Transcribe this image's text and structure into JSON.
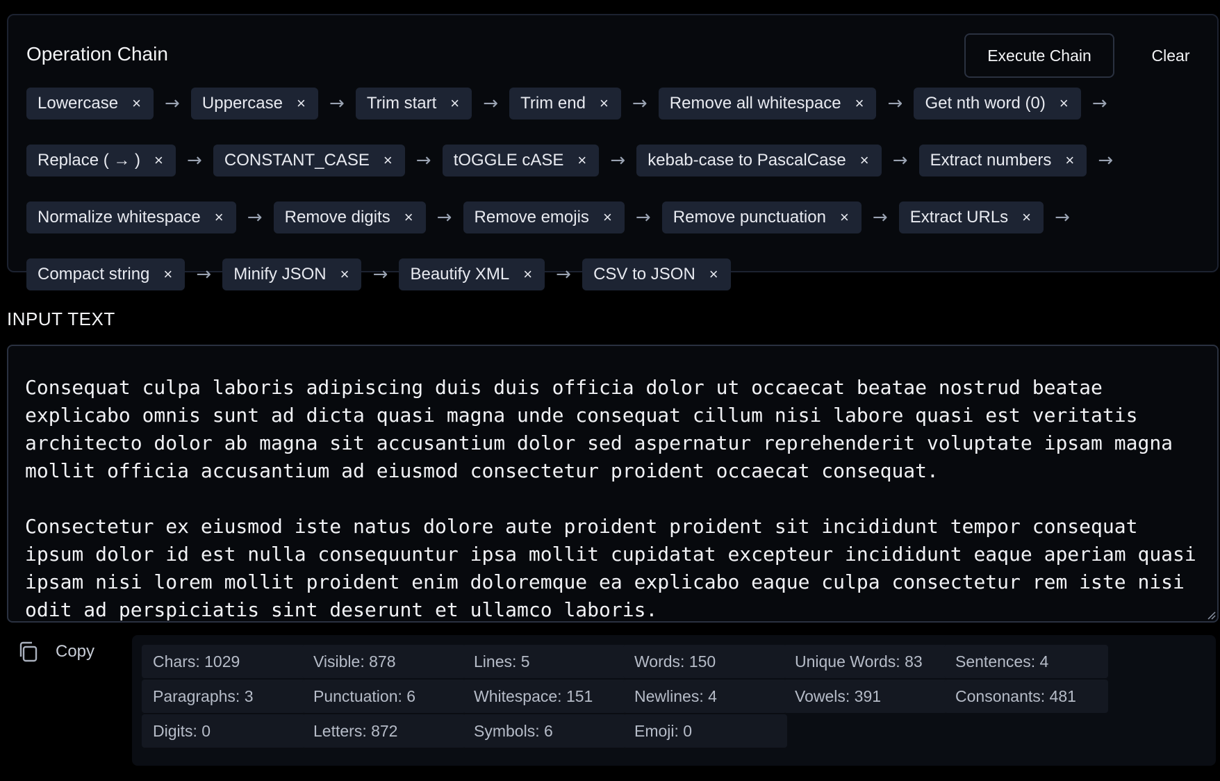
{
  "chain": {
    "title": "Operation Chain",
    "execute_label": "Execute Chain",
    "clear_label": "Clear",
    "close_glyph": "×",
    "arrow_glyph": "→",
    "operations": [
      "Lowercase",
      "Uppercase",
      "Trim start",
      "Trim end",
      "Remove all whitespace",
      "Get nth word (0)",
      "Replace ( → )",
      "CONSTANT_CASE",
      "tOGGLE cASE",
      "kebab-case to PascalCase",
      "Extract numbers",
      "Normalize whitespace",
      "Remove digits",
      "Remove emojis",
      "Remove punctuation",
      "Extract URLs",
      "Compact string",
      "Minify JSON",
      "Beautify XML",
      "CSV to JSON"
    ]
  },
  "input": {
    "label": "INPUT TEXT",
    "value": "Consequat culpa laboris adipiscing duis duis officia dolor ut occaecat beatae nostrud beatae explicabo omnis sunt ad dicta quasi magna unde consequat cillum nisi labore quasi est veritatis architecto dolor ab magna sit accusantium dolor sed aspernatur reprehenderit voluptate ipsam magna mollit officia accusantium ad eiusmod consectetur proident occaecat consequat.\n\nConsectetur ex eiusmod iste natus dolore aute proident proident sit incididunt tempor consequat ipsum dolor id est nulla consequuntur ipsa mollit cupidatat excepteur incididunt eaque aperiam quasi ipsam nisi lorem mollit proident enim doloremque ea explicabo eaque culpa consectetur rem iste nisi odit ad perspiciatis sint deserunt et ullamco laboris."
  },
  "copy": {
    "label": "Copy",
    "icon": "copy-icon"
  },
  "stats": [
    "Chars: 1029",
    "Visible: 878",
    "Lines: 5",
    "Words: 150",
    "Unique Words: 83",
    "Sentences: 4",
    "Paragraphs: 3",
    "Punctuation: 6",
    "Whitespace: 151",
    "Newlines: 4",
    "Vowels: 391",
    "Consonants: 481",
    "Digits: 0",
    "Letters: 872",
    "Symbols: 6",
    "Emoji: 0"
  ]
}
